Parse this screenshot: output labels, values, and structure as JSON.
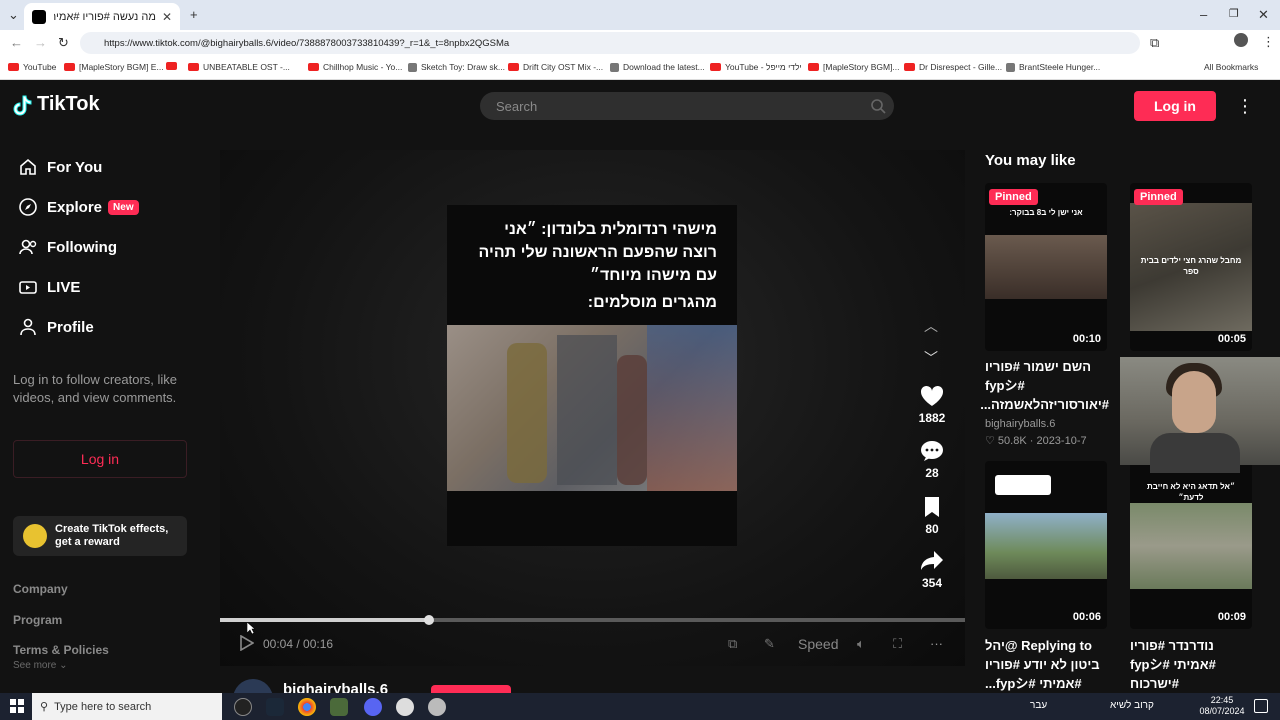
{
  "browser": {
    "tab_title": "מה נעשה #פוריו #אמיתי 🙏",
    "url": "https://www.tiktok.com/@bighairyballs.6/video/7388878003733810439?_r=1&_t=8npbx2QGSMa",
    "bookmarks": [
      {
        "label": "YouTube",
        "type": "yt"
      },
      {
        "label": "[MapleStory BGM] E...",
        "type": "yt"
      },
      {
        "label": "",
        "type": "yt"
      },
      {
        "label": "UNBEATABLE OST -...",
        "type": "yt"
      },
      {
        "label": "Chillhop Music - Yo...",
        "type": "yt"
      },
      {
        "label": "Sketch Toy: Draw sk...",
        "type": "gen"
      },
      {
        "label": "Drift City OST Mix -...",
        "type": "yt"
      },
      {
        "label": "Download the latest...",
        "type": "gen"
      },
      {
        "label": "YouTube - ילדי מייפל",
        "type": "yt"
      },
      {
        "label": "[MapleStory BGM]...",
        "type": "yt"
      },
      {
        "label": "Dr Disrespect - Gille...",
        "type": "yt"
      },
      {
        "label": "BrantSteele Hunger...",
        "type": "gen"
      }
    ],
    "all_bookmarks": "All Bookmarks"
  },
  "header": {
    "logo": "TikTok",
    "search_placeholder": "Search",
    "login": "Log in"
  },
  "sidebar": {
    "items": [
      {
        "label": "For You",
        "icon": "home-icon"
      },
      {
        "label": "Explore",
        "icon": "compass-icon",
        "badge": "New"
      },
      {
        "label": "Following",
        "icon": "following-icon"
      },
      {
        "label": "LIVE",
        "icon": "live-icon"
      },
      {
        "label": "Profile",
        "icon": "profile-icon"
      }
    ],
    "login_message": "Log in to follow creators, like videos, and view comments.",
    "login_button": "Log in",
    "effects_label": "Create TikTok effects, get a reward",
    "footer_links": [
      "Company",
      "Program",
      "Terms & Policies"
    ],
    "see_more": "See more"
  },
  "video": {
    "caption_line1": "מישהי רנדומלית בלונדון: ״אני רוצה שהפעם הראשונה שלי תהיה עם מישהו מיוחד״",
    "caption_line2": "מהגרים מוסלמים:",
    "likes": "1882",
    "comments": "28",
    "saves": "80",
    "shares": "354",
    "current_time": "00:04",
    "duration": "00:16",
    "progress": 0.28,
    "speed": "Speed",
    "author": "bighairyballs.6"
  },
  "sidebar_right": {
    "title": "You may like",
    "cards": [
      {
        "pinned": "Pinned",
        "duration": "00:10",
        "thumb_caption": "אני ישן לי ב8 בבוקר:",
        "description": "השם ישמור #פוריו #fypシ #יאורסוריזהלאשמזה...",
        "author": "bighairyballs.6",
        "likes": "50.8K",
        "date": "2023-10-7"
      },
      {
        "pinned": "Pinned",
        "duration": "00:05",
        "thumb_caption": "מחבל שהרג חצי ילדים בבית ספר",
        "description": "",
        "author": "",
        "likes": "",
        "date": ""
      },
      {
        "pinned": "",
        "duration": "00:06",
        "thumb_caption": "",
        "description": "Replying to @יהל ביטון לא יודע #פוריו #אמיתי #fypシ...",
        "author": "",
        "likes": "",
        "date": ""
      },
      {
        "pinned": "",
        "duration": "00:09",
        "thumb_caption": "״אל תדאג היא לא חייבת לדעת״",
        "description": "נודרנדר #פוריו #אמיתי #fypシ #ישרכוח #חרבותברזל...",
        "author": "",
        "likes": "",
        "date": ""
      }
    ]
  },
  "taskbar": {
    "search_placeholder": "Type here to search",
    "tray_lang": "עבר",
    "tray_text": "קרוב לשיא",
    "time": "22:45",
    "date": "08/07/2024"
  },
  "colors": {
    "accent": "#fe2c55",
    "bg": "#121212"
  }
}
